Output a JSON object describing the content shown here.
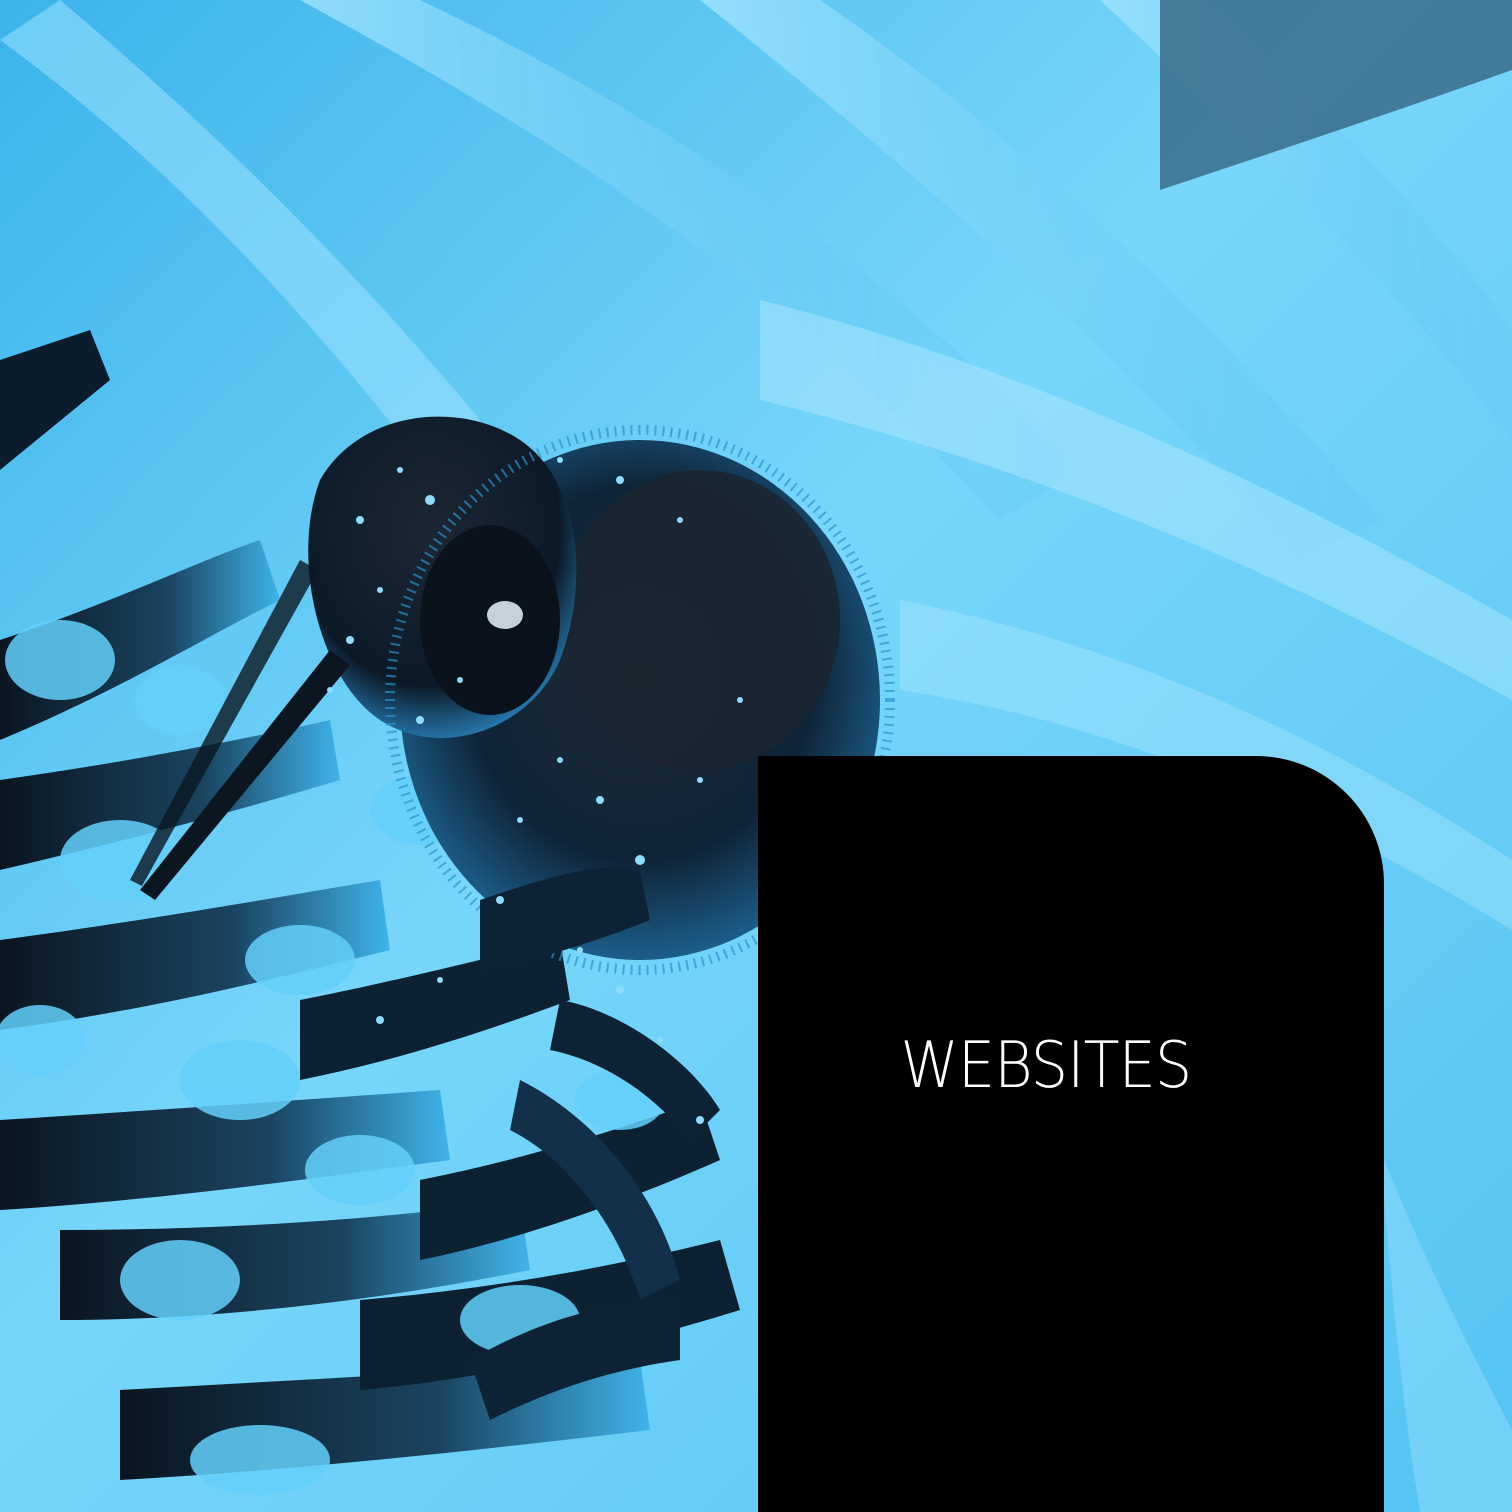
{
  "card": {
    "title": "WEBSITES"
  },
  "photo": {
    "subject": "bee",
    "tint": "#5ec8f2"
  }
}
